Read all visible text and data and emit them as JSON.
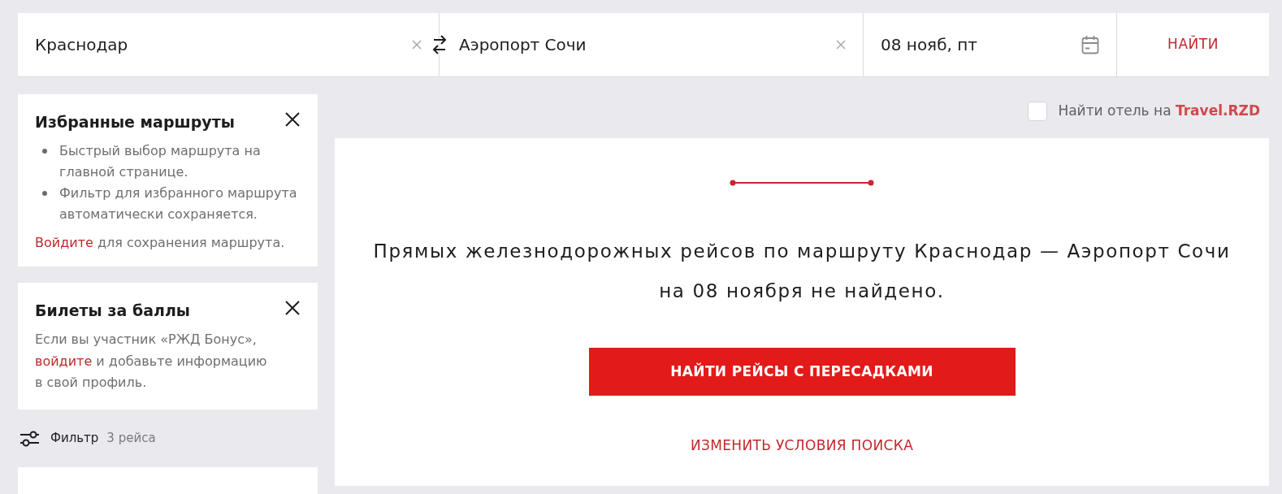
{
  "search_form": {
    "from_value": "Краснодар",
    "to_value": "Аэропорт Сочи",
    "date_value": "08 нояб, пт",
    "search_button": "НАЙТИ"
  },
  "sidebar": {
    "cards": [
      {
        "kind": "bullets",
        "title": "Избранные маршруты",
        "items": [
          "Быстрый выбор маршрута на главной странице.",
          "Фильтр для избранного маршрута автоматически сохраняется."
        ],
        "note": [
          {
            "kind": "link",
            "text": "Войдите"
          },
          {
            "kind": "text",
            "text": "для сохранения маршрута."
          }
        ]
      },
      {
        "kind": "text",
        "title": "Билеты за баллы",
        "note": [
          {
            "kind": "text",
            "text": "Если вы участник «РЖД Бонус»,"
          },
          {
            "kind": "link",
            "text": "войдите"
          },
          {
            "kind": "text",
            "text": "и добавьте информацию в свой профиль."
          }
        ]
      }
    ],
    "filter": {
      "label": "Фильтр",
      "count": "3 рейса"
    }
  },
  "hotel_option": {
    "checked": false,
    "label": [
      {
        "kind": "text",
        "text": "Найти отель на"
      },
      {
        "kind": "link",
        "text": "Travel.RZD"
      }
    ]
  },
  "result": {
    "message": "Прямых железнодорожных рейсов по маршруту Краснодар — Аэропорт Сочи на 08 ноября не найдено.",
    "primary_button": "НАЙТИ РЕЙСЫ С ПЕРЕСАДКАМИ",
    "secondary_button": "ИЗМЕНИТЬ УСЛОВИЯ ПОИСКА"
  }
}
